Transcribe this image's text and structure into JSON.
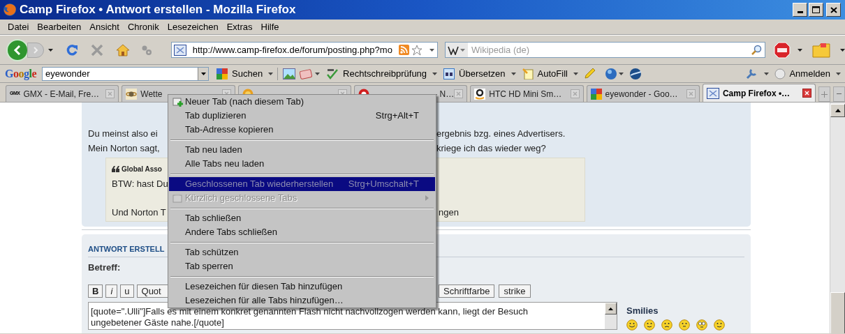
{
  "window": {
    "title": "Camp Firefox • Antwort erstellen - Mozilla Firefox"
  },
  "menu_bar": [
    "Datei",
    "Bearbeiten",
    "Ansicht",
    "Chronik",
    "Lesezeichen",
    "Extras",
    "Hilfe"
  ],
  "navigation": {
    "url": "http://www.camp-firefox.de/forum/posting.php?mo",
    "search": {
      "placeholder": "Wikipedia (de)"
    }
  },
  "google_toolbar": {
    "logo": "Google",
    "query": "eyewonder",
    "buttons": [
      {
        "label": "Suchen"
      },
      {
        "label": "Rechtschreibprüfung"
      },
      {
        "label": "Übersetzen"
      },
      {
        "label": "AutoFill"
      }
    ],
    "sign_in": "Anmelden"
  },
  "tabs": [
    {
      "badge": "GMX",
      "label": "GMX - E-Mail, Fre…",
      "selected": false,
      "clipped_start": false
    },
    {
      "label": "Wette",
      "selected": false,
      "clipped_start": false
    },
    {
      "selected": false
    },
    {
      "label": "- N…",
      "selected": false,
      "clipped_start": true
    },
    {
      "label": "HTC HD Mini Sm…",
      "selected": false,
      "clipped_start": false
    },
    {
      "label": "eyewonder - Goo…",
      "selected": false,
      "clipped_start": false
    },
    {
      "label": "Camp Firefox •…",
      "selected": true,
      "clipped_start": false
    }
  ],
  "post": {
    "lines": [
      {
        "left": "Du meinst also ei",
        "right": "ergebnis bzg. eines Advertisers."
      },
      {
        "left": "Mein Norton sagt,",
        "right": "kriege ich das wieder weg?"
      }
    ],
    "quote": {
      "author": "Global Asso",
      "lines": [
        {
          "left": "BTW: hast Du"
        },
        {
          "left": "Und Norton T",
          "right": "ngen"
        }
      ]
    }
  },
  "reply": {
    "heading": "ANTWORT ERSTELL",
    "subject_label": "Betreff:",
    "format_buttons_left": [
      {
        "label": "B"
      },
      {
        "label": "i"
      },
      {
        "label": "u"
      },
      {
        "label": "Quot"
      }
    ],
    "format_buttons_right": [
      {
        "label": "Schriftfarbe"
      },
      {
        "label": "strike"
      }
    ],
    "message": [
      "[quote=\".Ulli\"]Falls es mit einem konkret genannten Flash nicht nachvollzogen werden kann, liegt der Besuch",
      "ungebetener Gäste nahe.[/quote]"
    ],
    "smilies_label": "Smilies"
  },
  "context_menu": [
    {
      "kind": "item",
      "label": "Neuer Tab  (nach diesem Tab)",
      "disabled": false,
      "selected": false,
      "submenu": false
    },
    {
      "kind": "item",
      "label": "Tab duplizieren",
      "shortcut": "Strg+Alt+T",
      "disabled": false,
      "selected": false,
      "submenu": false
    },
    {
      "kind": "item",
      "label": "Tab-Adresse kopieren",
      "disabled": false,
      "selected": false,
      "submenu": false
    },
    {
      "kind": "separator"
    },
    {
      "kind": "item",
      "label": "Tab neu laden",
      "disabled": false,
      "selected": false,
      "submenu": false
    },
    {
      "kind": "item",
      "label": "Alle Tabs neu laden",
      "disabled": false,
      "selected": false,
      "submenu": false
    },
    {
      "kind": "separator"
    },
    {
      "kind": "item",
      "label": "Geschlossenen Tab wiederherstellen",
      "shortcut": "Strg+Umschalt+T",
      "disabled": true,
      "selected": true,
      "submenu": false
    },
    {
      "kind": "item",
      "label": "Kürzlich geschlossene Tabs",
      "disabled": true,
      "selected": false,
      "submenu": true
    },
    {
      "kind": "separator"
    },
    {
      "kind": "item",
      "label": "Tab schließen",
      "disabled": false,
      "selected": false,
      "submenu": false
    },
    {
      "kind": "item",
      "label": "Andere Tabs schließen",
      "disabled": false,
      "selected": false,
      "submenu": false
    },
    {
      "kind": "separator"
    },
    {
      "kind": "item",
      "label": "Tab schützen",
      "disabled": false,
      "selected": false,
      "submenu": false
    },
    {
      "kind": "item",
      "label": "Tab sperren",
      "disabled": false,
      "selected": false,
      "submenu": false
    },
    {
      "kind": "separator"
    },
    {
      "kind": "item",
      "label": "Lesezeichen für diesen Tab hinzufügen",
      "disabled": false,
      "selected": false,
      "submenu": false
    },
    {
      "kind": "item",
      "label": "Lesezeichen für alle Tabs hinzufügen…",
      "disabled": false,
      "selected": false,
      "submenu": false
    }
  ]
}
